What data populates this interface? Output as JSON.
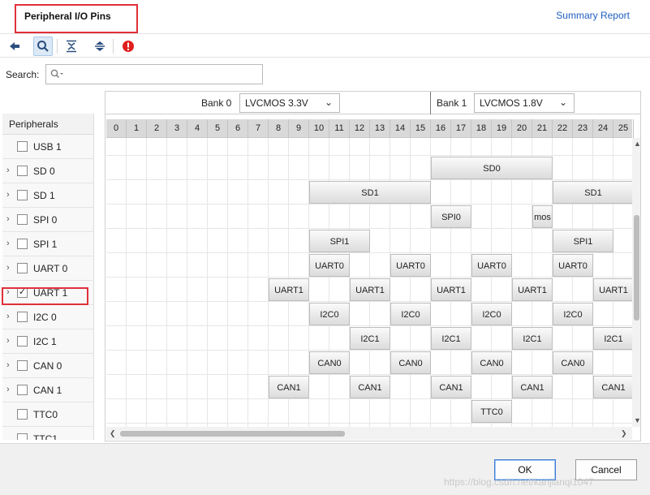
{
  "header": {
    "title": "Peripheral I/O Pins",
    "summary_link": "Summary Report"
  },
  "toolbar": {
    "buttons": [
      {
        "icon": "back-arrow-icon"
      },
      {
        "icon": "search-icon",
        "active": true
      },
      {
        "icon": "collapse-all-icon"
      },
      {
        "icon": "expand-all-icon"
      },
      {
        "icon": "error-icon",
        "color": "#e02020"
      }
    ]
  },
  "search": {
    "label": "Search:",
    "placeholder": "",
    "value": ""
  },
  "sidebar": {
    "header": "Peripherals",
    "items": [
      {
        "label": "USB 1",
        "expandable": false,
        "checked": false
      },
      {
        "label": "SD 0",
        "expandable": true,
        "checked": false
      },
      {
        "label": "SD 1",
        "expandable": true,
        "checked": false
      },
      {
        "label": "SPI 0",
        "expandable": true,
        "checked": false
      },
      {
        "label": "SPI 1",
        "expandable": true,
        "checked": false
      },
      {
        "label": "UART 0",
        "expandable": true,
        "checked": false
      },
      {
        "label": "UART 1",
        "expandable": true,
        "checked": true
      },
      {
        "label": "I2C 0",
        "expandable": true,
        "checked": false
      },
      {
        "label": "I2C 1",
        "expandable": true,
        "checked": false
      },
      {
        "label": "CAN 0",
        "expandable": true,
        "checked": false
      },
      {
        "label": "CAN 1",
        "expandable": true,
        "checked": false
      },
      {
        "label": "TTC0",
        "expandable": false,
        "checked": false
      },
      {
        "label": "TTC1",
        "expandable": false,
        "checked": false
      }
    ]
  },
  "banks": [
    {
      "label": "Bank 0",
      "value": "LVCMOS 3.3V"
    },
    {
      "label": "Bank 1",
      "value": "LVCMOS 1.8V"
    }
  ],
  "grid": {
    "columns": [
      "0",
      "1",
      "2",
      "3",
      "4",
      "5",
      "6",
      "7",
      "8",
      "9",
      "10",
      "11",
      "12",
      "13",
      "14",
      "15",
      "16",
      "17",
      "18",
      "19",
      "20",
      "21",
      "22",
      "23",
      "24",
      "25"
    ],
    "blocks": [
      {
        "row": 1,
        "start": 16,
        "span": 6,
        "label": "SD0"
      },
      {
        "row": 2,
        "start": 10,
        "span": 6,
        "label": "SD1"
      },
      {
        "row": 2,
        "start": 22,
        "span": 4,
        "label": "SD1"
      },
      {
        "row": 3,
        "start": 16,
        "span": 2,
        "label": "SPI0"
      },
      {
        "row": 3,
        "start": 21,
        "span": 1,
        "label": "mos"
      },
      {
        "row": 4,
        "start": 10,
        "span": 3,
        "label": "SPI1"
      },
      {
        "row": 4,
        "start": 22,
        "span": 3,
        "label": "SPI1"
      },
      {
        "row": 5,
        "start": 10,
        "span": 2,
        "label": "UART0"
      },
      {
        "row": 5,
        "start": 14,
        "span": 2,
        "label": "UART0"
      },
      {
        "row": 5,
        "start": 18,
        "span": 2,
        "label": "UART0"
      },
      {
        "row": 5,
        "start": 22,
        "span": 2,
        "label": "UART0"
      },
      {
        "row": 6,
        "start": 8,
        "span": 2,
        "label": "UART1"
      },
      {
        "row": 6,
        "start": 12,
        "span": 2,
        "label": "UART1"
      },
      {
        "row": 6,
        "start": 16,
        "span": 2,
        "label": "UART1"
      },
      {
        "row": 6,
        "start": 20,
        "span": 2,
        "label": "UART1"
      },
      {
        "row": 6,
        "start": 24,
        "span": 2,
        "label": "UART1"
      },
      {
        "row": 7,
        "start": 10,
        "span": 2,
        "label": "I2C0"
      },
      {
        "row": 7,
        "start": 14,
        "span": 2,
        "label": "I2C0"
      },
      {
        "row": 7,
        "start": 18,
        "span": 2,
        "label": "I2C0"
      },
      {
        "row": 7,
        "start": 22,
        "span": 2,
        "label": "I2C0"
      },
      {
        "row": 8,
        "start": 12,
        "span": 2,
        "label": "I2C1"
      },
      {
        "row": 8,
        "start": 16,
        "span": 2,
        "label": "I2C1"
      },
      {
        "row": 8,
        "start": 20,
        "span": 2,
        "label": "I2C1"
      },
      {
        "row": 8,
        "start": 24,
        "span": 2,
        "label": "I2C1"
      },
      {
        "row": 9,
        "start": 10,
        "span": 2,
        "label": "CAN0"
      },
      {
        "row": 9,
        "start": 14,
        "span": 2,
        "label": "CAN0"
      },
      {
        "row": 9,
        "start": 18,
        "span": 2,
        "label": "CAN0"
      },
      {
        "row": 9,
        "start": 22,
        "span": 2,
        "label": "CAN0"
      },
      {
        "row": 10,
        "start": 8,
        "span": 2,
        "label": "CAN1"
      },
      {
        "row": 10,
        "start": 12,
        "span": 2,
        "label": "CAN1"
      },
      {
        "row": 10,
        "start": 16,
        "span": 2,
        "label": "CAN1"
      },
      {
        "row": 10,
        "start": 20,
        "span": 2,
        "label": "CAN1"
      },
      {
        "row": 10,
        "start": 24,
        "span": 2,
        "label": "CAN1"
      },
      {
        "row": 11,
        "start": 18,
        "span": 2,
        "label": "TTC0"
      }
    ]
  },
  "footer": {
    "ok_label": "OK",
    "cancel_label": "Cancel",
    "watermark": "https://blog.csdn.net/kanjianqi1047"
  },
  "colors": {
    "accent": "#1f5fbf",
    "highlight": "#e0313a",
    "error": "#e02020"
  }
}
